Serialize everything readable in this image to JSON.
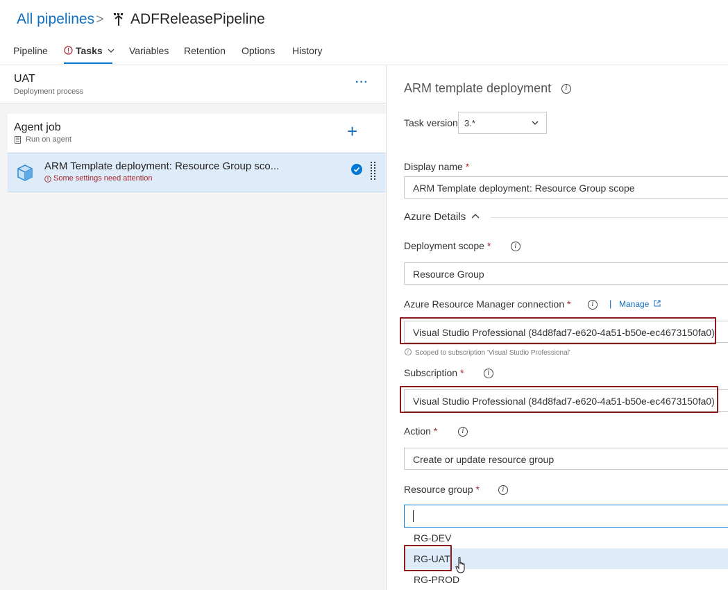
{
  "header": {
    "breadcrumb_root": "All pipelines",
    "separator": ">",
    "pipeline_name": "ADFReleasePipeline"
  },
  "tabs": [
    {
      "label": "Pipeline"
    },
    {
      "label": "Tasks",
      "active": true,
      "warning": true
    },
    {
      "label": "Variables"
    },
    {
      "label": "Retention"
    },
    {
      "label": "Options"
    },
    {
      "label": "History"
    }
  ],
  "stage": {
    "title": "UAT",
    "subtitle": "Deployment process",
    "more_label": "···"
  },
  "agent_job": {
    "title": "Agent job",
    "subtitle": "Run on agent",
    "add_label": "+"
  },
  "task": {
    "title": "ARM Template deployment: Resource Group sco...",
    "warning": "Some settings need attention"
  },
  "panel": {
    "title": "ARM template deployment",
    "task_version_label": "Task version",
    "task_version_value": "3.*",
    "display_name_label": "Display name",
    "display_name_value": "ARM Template deployment: Resource Group scope",
    "section_label": "Azure Details",
    "deployment_scope_label": "Deployment scope",
    "deployment_scope_value": "Resource Group",
    "arm_connection_label": "Azure Resource Manager connection",
    "manage_label": "Manage",
    "arm_connection_value": "Visual Studio Professional (84d8fad7-e620-4a51-b50e-ec4673150fa0)",
    "arm_connection_hint": "Scoped to subscription 'Visual Studio Professional'",
    "subscription_label": "Subscription",
    "subscription_value": "Visual Studio Professional (84d8fad7-e620-4a51-b50e-ec4673150fa0)",
    "action_label": "Action",
    "action_value": "Create or update resource group",
    "resource_group_label": "Resource group",
    "resource_group_value": "",
    "required_mark": "*"
  },
  "resource_group_options": [
    "RG-DEV",
    "RG-UAT",
    "RG-PROD"
  ],
  "colors": {
    "accent": "#0078d4",
    "link": "#106ebe",
    "error": "#a4262c",
    "highlight_box": "#8b1a1a",
    "selected_row": "#deecf9"
  }
}
